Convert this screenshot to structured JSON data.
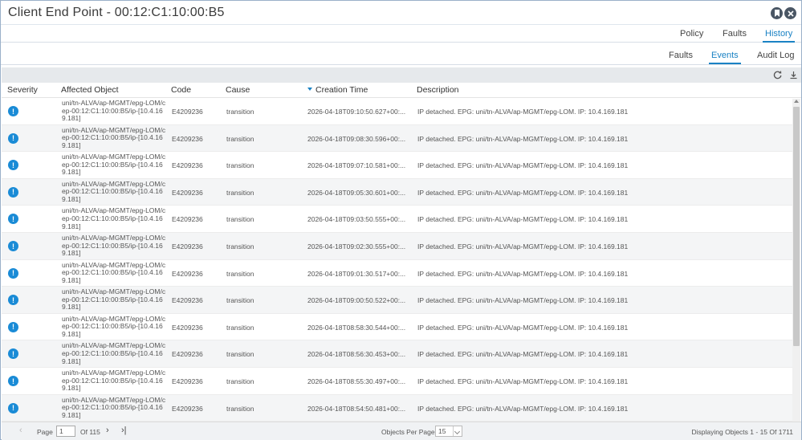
{
  "window": {
    "title": "Client End Point - 00:12:C1:10:00:B5"
  },
  "tabs_primary": [
    {
      "label": "Policy",
      "active": false
    },
    {
      "label": "Faults",
      "active": false
    },
    {
      "label": "History",
      "active": true
    }
  ],
  "tabs_secondary": [
    {
      "label": "Faults",
      "active": false
    },
    {
      "label": "Events",
      "active": true
    },
    {
      "label": "Audit Log",
      "active": false
    }
  ],
  "toolbar": {
    "icons": [
      "refresh-icon",
      "download-icon"
    ]
  },
  "table": {
    "columns": [
      "Severity",
      "Affected Object",
      "Code",
      "Cause",
      "Creation Time",
      "Description"
    ],
    "sorted_column": "Creation Time",
    "rows": [
      {
        "object": "uni/tn-ALVA/ap-MGMT/epg-LOM/cep-00:12:C1:10:00:B5/ip-[10.4.169.181]",
        "code": "E4209236",
        "cause": "transition",
        "time": "2026-04-18T09:10:50.627+00:...",
        "description": "IP detached. EPG: uni/tn-ALVA/ap-MGMT/epg-LOM. IP: 10.4.169.181"
      },
      {
        "object": "uni/tn-ALVA/ap-MGMT/epg-LOM/cep-00:12:C1:10:00:B5/ip-[10.4.169.181]",
        "code": "E4209236",
        "cause": "transition",
        "time": "2026-04-18T09:08:30.596+00:...",
        "description": "IP detached. EPG: uni/tn-ALVA/ap-MGMT/epg-LOM. IP: 10.4.169.181"
      },
      {
        "object": "uni/tn-ALVA/ap-MGMT/epg-LOM/cep-00:12:C1:10:00:B5/ip-[10.4.169.181]",
        "code": "E4209236",
        "cause": "transition",
        "time": "2026-04-18T09:07:10.581+00:...",
        "description": "IP detached. EPG: uni/tn-ALVA/ap-MGMT/epg-LOM. IP: 10.4.169.181"
      },
      {
        "object": "uni/tn-ALVA/ap-MGMT/epg-LOM/cep-00:12:C1:10:00:B5/ip-[10.4.169.181]",
        "code": "E4209236",
        "cause": "transition",
        "time": "2026-04-18T09:05:30.601+00:...",
        "description": "IP detached. EPG: uni/tn-ALVA/ap-MGMT/epg-LOM. IP: 10.4.169.181"
      },
      {
        "object": "uni/tn-ALVA/ap-MGMT/epg-LOM/cep-00:12:C1:10:00:B5/ip-[10.4.169.181]",
        "code": "E4209236",
        "cause": "transition",
        "time": "2026-04-18T09:03:50.555+00:...",
        "description": "IP detached. EPG: uni/tn-ALVA/ap-MGMT/epg-LOM. IP: 10.4.169.181"
      },
      {
        "object": "uni/tn-ALVA/ap-MGMT/epg-LOM/cep-00:12:C1:10:00:B5/ip-[10.4.169.181]",
        "code": "E4209236",
        "cause": "transition",
        "time": "2026-04-18T09:02:30.555+00:...",
        "description": "IP detached. EPG: uni/tn-ALVA/ap-MGMT/epg-LOM. IP: 10.4.169.181"
      },
      {
        "object": "uni/tn-ALVA/ap-MGMT/epg-LOM/cep-00:12:C1:10:00:B5/ip-[10.4.169.181]",
        "code": "E4209236",
        "cause": "transition",
        "time": "2026-04-18T09:01:30.517+00:...",
        "description": "IP detached. EPG: uni/tn-ALVA/ap-MGMT/epg-LOM. IP: 10.4.169.181"
      },
      {
        "object": "uni/tn-ALVA/ap-MGMT/epg-LOM/cep-00:12:C1:10:00:B5/ip-[10.4.169.181]",
        "code": "E4209236",
        "cause": "transition",
        "time": "2026-04-18T09:00:50.522+00:...",
        "description": "IP detached. EPG: uni/tn-ALVA/ap-MGMT/epg-LOM. IP: 10.4.169.181"
      },
      {
        "object": "uni/tn-ALVA/ap-MGMT/epg-LOM/cep-00:12:C1:10:00:B5/ip-[10.4.169.181]",
        "code": "E4209236",
        "cause": "transition",
        "time": "2026-04-18T08:58:30.544+00:...",
        "description": "IP detached. EPG: uni/tn-ALVA/ap-MGMT/epg-LOM. IP: 10.4.169.181"
      },
      {
        "object": "uni/tn-ALVA/ap-MGMT/epg-LOM/cep-00:12:C1:10:00:B5/ip-[10.4.169.181]",
        "code": "E4209236",
        "cause": "transition",
        "time": "2026-04-18T08:56:30.453+00:...",
        "description": "IP detached. EPG: uni/tn-ALVA/ap-MGMT/epg-LOM. IP: 10.4.169.181"
      },
      {
        "object": "uni/tn-ALVA/ap-MGMT/epg-LOM/cep-00:12:C1:10:00:B5/ip-[10.4.169.181]",
        "code": "E4209236",
        "cause": "transition",
        "time": "2026-04-18T08:55:30.497+00:...",
        "description": "IP detached. EPG: uni/tn-ALVA/ap-MGMT/epg-LOM. IP: 10.4.169.181"
      },
      {
        "object": "uni/tn-ALVA/ap-MGMT/epg-LOM/cep-00:12:C1:10:00:B5/ip-[10.4.169.181]",
        "code": "E4209236",
        "cause": "transition",
        "time": "2026-04-18T08:54:50.481+00:...",
        "description": "IP detached. EPG: uni/tn-ALVA/ap-MGMT/epg-LOM. IP: 10.4.169.181"
      }
    ]
  },
  "pagination": {
    "page_label": "Page",
    "page_value": "1",
    "of_label": "Of 115",
    "per_page_label": "Objects Per Page:",
    "per_page_value": "15",
    "display_text": "Displaying Objects 1 - 15 Of 1711"
  },
  "colors": {
    "accent": "#1a82c4",
    "severity_info": "#1a8bd6",
    "toolbar_bg": "#e6e9ec"
  }
}
